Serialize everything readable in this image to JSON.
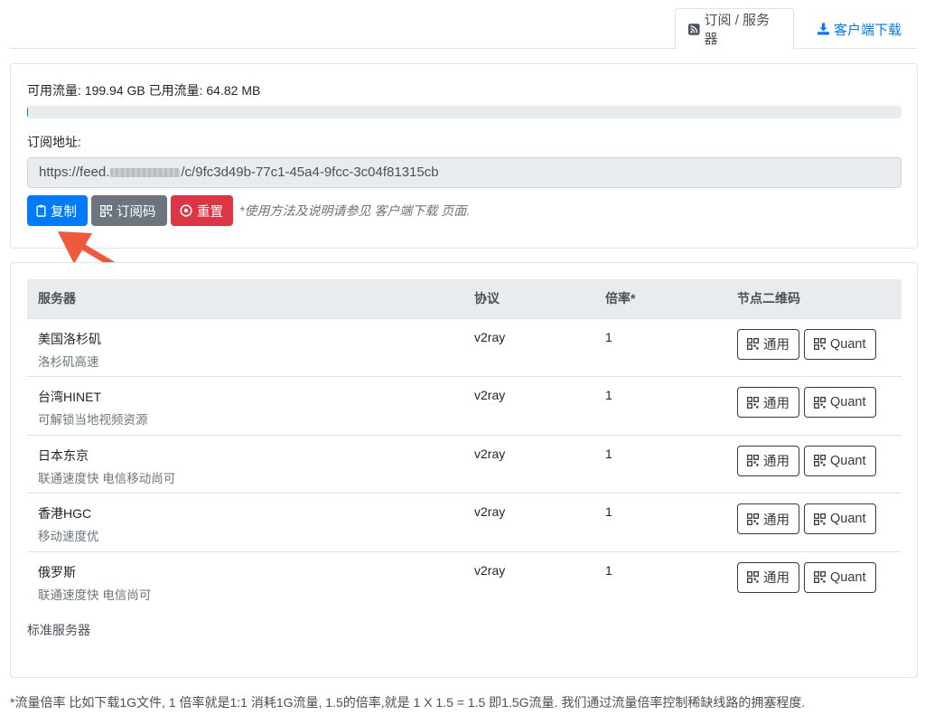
{
  "tabs": {
    "subscription_label": "订阅 / 服务器",
    "download_label": "客户端下载"
  },
  "traffic": {
    "available_label": "可用流量:",
    "available_value": "199.94 GB",
    "used_label": "已用流量:",
    "used_value": "64.82 MB",
    "used_fraction": 0.0003
  },
  "subscription": {
    "label": "订阅地址:",
    "url_prefix": "https://feed.",
    "url_suffix": "/c/9fc3d49b-77c1-45a4-9fcc-3c04f81315cb"
  },
  "actions": {
    "copy_label": "复制",
    "qrcode_label": "订阅码",
    "reset_label": "重置",
    "hint": "*使用方法及说明请参见 客户端下载 页面."
  },
  "table": {
    "headers": [
      "服务器",
      "协议",
      "倍率*",
      "节点二维码"
    ],
    "rows": [
      {
        "name": "美国洛杉矶",
        "desc": "洛杉矶高速",
        "protocol": "v2ray",
        "rate": "1"
      },
      {
        "name": "台湾HINET",
        "desc": "可解锁当地视频资源",
        "protocol": "v2ray",
        "rate": "1"
      },
      {
        "name": "日本东京",
        "desc": "联通速度快 电信移动尚可",
        "protocol": "v2ray",
        "rate": "1"
      },
      {
        "name": "香港HGC",
        "desc": "移动速度优",
        "protocol": "v2ray",
        "rate": "1"
      },
      {
        "name": "俄罗斯",
        "desc": "联通速度快 电信尚可",
        "protocol": "v2ray",
        "rate": "1"
      }
    ],
    "generic_btn": "通用",
    "quant_btn": "Quant"
  },
  "standard_servers_label": "标准服务器",
  "footnote": "*流量倍率 比如下载1G文件, 1 倍率就是1:1 消耗1G流量, 1.5的倍率,就是 1 X 1.5 = 1.5 即1.5G流量. 我们通过流量倍率控制稀缺线路的拥塞程度.",
  "colors": {
    "primary": "#007bff",
    "secondary": "#6c757d",
    "danger": "#dc3545",
    "arrow": "#f05a3c"
  },
  "icons": [
    "rss-icon",
    "download-icon",
    "clipboard-icon",
    "qrcode-icon",
    "reset-icon",
    "arrow-annotation"
  ]
}
